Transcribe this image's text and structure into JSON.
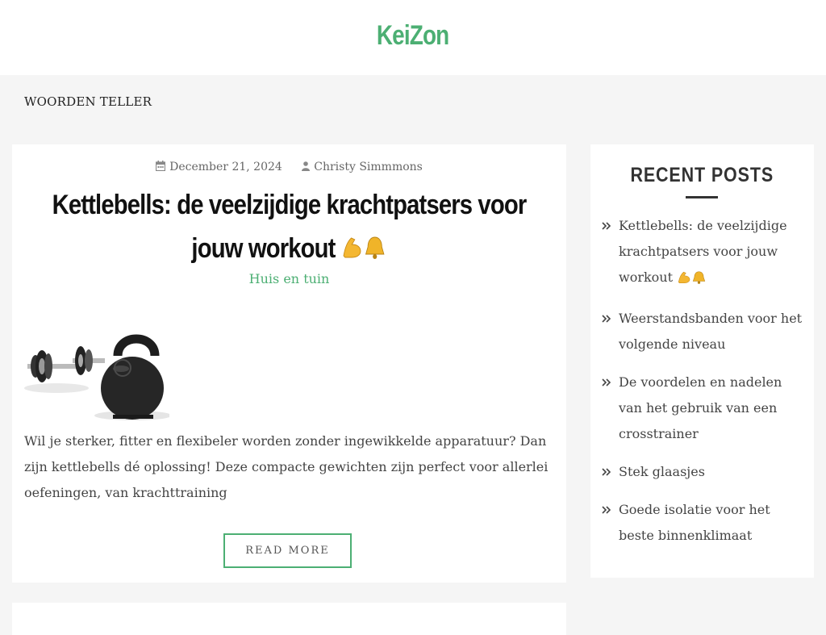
{
  "site": {
    "title": "KeiZon"
  },
  "page": {
    "heading": "WOORDEN TELLER"
  },
  "post": {
    "date": "December 21, 2024",
    "author": "Christy Simmmons",
    "title": "Kettlebells: de veelzijdige krachtpatsers voor jouw workout",
    "category": "Huis en tuin",
    "excerpt": "Wil je sterker, fitter en flexibeler worden zonder ingewikkelde apparatuur? Dan zijn kettlebells dé oplossing! Deze compacte gewichten zijn perfect voor allerlei oefeningen, van krachttraining",
    "read_more": "READ MORE"
  },
  "sidebar": {
    "title": "RECENT POSTS",
    "items": [
      {
        "label": "Kettlebells: de veelzijdige krachtpatsers voor jouw workout"
      },
      {
        "label": "Weerstandsbanden voor het volgende niveau"
      },
      {
        "label": "De voordelen en nadelen van het gebruik van een crosstrainer"
      },
      {
        "label": "Stek glaasjes"
      },
      {
        "label": "Goede isolatie voor het beste binnenklimaat"
      }
    ]
  },
  "colors": {
    "accent": "#4caf73",
    "background": "#f5f5f5"
  },
  "icons": {
    "date": "calendar-icon",
    "author": "user-icon",
    "list": "double-chevron-right-icon",
    "emoji": [
      "flexed-biceps-icon",
      "bell-icon"
    ]
  }
}
